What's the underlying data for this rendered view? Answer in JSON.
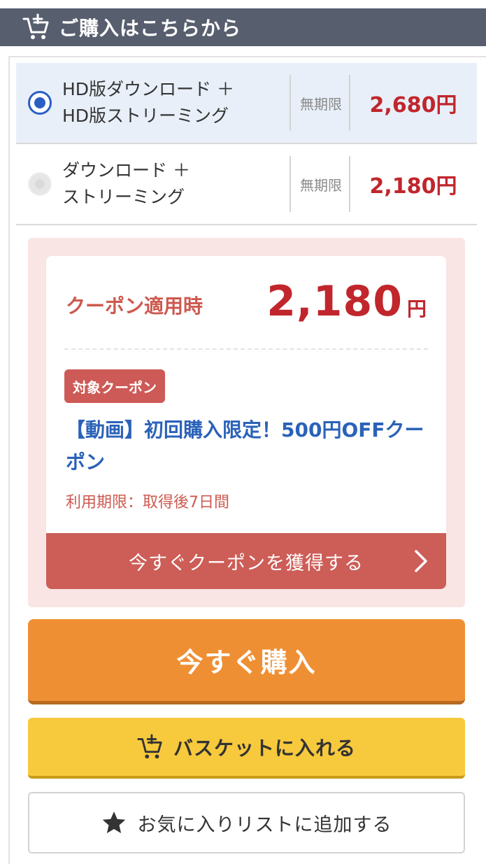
{
  "header": {
    "title": "ご購入はこちらから",
    "icon": "cart-plus-icon"
  },
  "options": [
    {
      "line1": "HD版ダウンロード ＋",
      "line2": "HD版ストリーミング",
      "term": "無期限",
      "price": "2,680円",
      "selected": true
    },
    {
      "line1": "ダウンロード ＋",
      "line2": "ストリーミング",
      "term": "無期限",
      "price": "2,180円",
      "selected": false
    }
  ],
  "coupon": {
    "label": "クーポン適用時",
    "price": "2,180",
    "yen": "円",
    "badge": "対象クーポン",
    "title": "【動画】初回購入限定！500円OFFクーポン",
    "period": "利用期限：取得後7日間",
    "get_button": "今すぐクーポンを獲得する"
  },
  "buttons": {
    "buy_now": "今すぐ購入",
    "add_basket": "バスケットに入れる",
    "add_favorite": "お気に入りリストに追加する"
  },
  "colors": {
    "header_bg": "#575e6e",
    "accent_red": "#c0262c",
    "coupon_red": "#cd5a56",
    "coupon_blue": "#2b62b8",
    "buy_orange": "#ef8f34",
    "basket_yellow": "#f7c93c",
    "radio_blue": "#2a5fc4"
  }
}
